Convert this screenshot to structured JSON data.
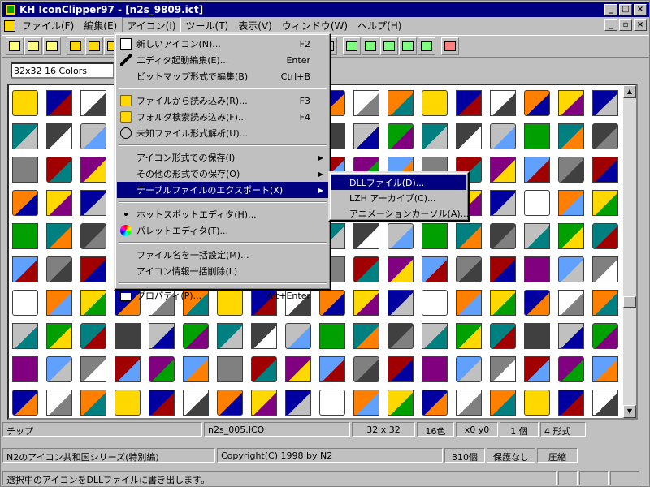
{
  "window": {
    "title": "KH IconClipper97 - [n2s_9809.ict]"
  },
  "menubar": [
    "ファイル(F)",
    "編集(E)",
    "アイコン(I)",
    "ツール(T)",
    "表示(V)",
    "ウィンドウ(W)",
    "ヘルプ(H)"
  ],
  "combo": {
    "value": "32x32  16 Colors"
  },
  "icon_menu": {
    "items": [
      {
        "label": "新しいアイコン(N)...",
        "shortcut": "F2",
        "icon": "new-icon"
      },
      {
        "label": "エディタ起動編集(E)...",
        "shortcut": "Enter",
        "icon": "pen-icon"
      },
      {
        "label": "ビットマップ形式で編集(B)",
        "shortcut": "Ctrl+B",
        "icon": ""
      },
      {
        "label": "ファイルから読み込み(R)...",
        "shortcut": "F3",
        "icon": "open-file-icon"
      },
      {
        "label": "フォルダ検索読み込み(F)...",
        "shortcut": "F4",
        "icon": "folder-search-icon"
      },
      {
        "label": "未知ファイル形式解析(U)...",
        "shortcut": "",
        "icon": "analyze-icon"
      },
      {
        "label": "アイコン形式での保存(I)",
        "submenu": true
      },
      {
        "label": "その他の形式での保存(O)",
        "submenu": true
      },
      {
        "label": "テーブルファイルのエクスポート(X)",
        "submenu": true,
        "highlighted": true
      },
      {
        "label": "ホットスポットエディタ(H)...",
        "icon": "hotspot-icon"
      },
      {
        "label": "パレットエディタ(T)...",
        "icon": "palette-icon"
      },
      {
        "label": "ファイル名を一括設定(M)...",
        "icon": ""
      },
      {
        "label": "アイコン情報一括削除(L)",
        "icon": ""
      },
      {
        "label": "プロパティ(P)...",
        "shortcut": "Alt+Enter",
        "icon": "properties-icon"
      }
    ]
  },
  "submenu": {
    "items": [
      {
        "label": "DLLファイル(D)...",
        "highlighted": true
      },
      {
        "label": "LZH アーカイブ(C)..."
      },
      {
        "label": "アニメーションカーソル(A)..."
      }
    ]
  },
  "status1": {
    "tip": "チップ",
    "file": "n2s_005.ICO",
    "size": "32 x 32",
    "colors": "16色",
    "hotspot": "x0  y0",
    "count": "1 個",
    "formats": "4 形式"
  },
  "status2": {
    "name": "N2のアイコン共和国シリーズ(特別編)",
    "copyright": "Copyright(C) 1998 by N2",
    "total": "310個",
    "protect": "保護なし",
    "compress": "圧縮"
  },
  "status3": {
    "message": "選択中のアイコンをDLLファイルに書き出します。"
  },
  "colors": {
    "title": "#000080",
    "highlight": "#000080"
  }
}
